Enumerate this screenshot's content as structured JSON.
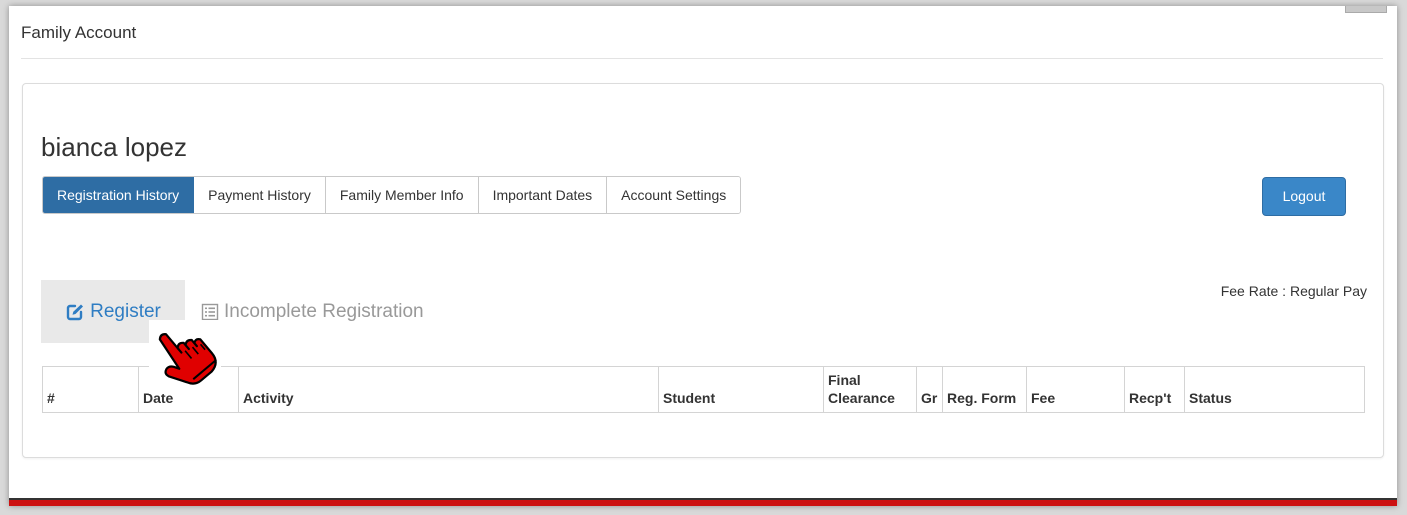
{
  "page": {
    "title": "Family Account"
  },
  "account": {
    "name": "bianca lopez"
  },
  "tabs": [
    {
      "label": "Registration History",
      "active": true
    },
    {
      "label": "Payment History",
      "active": false
    },
    {
      "label": "Family Member Info",
      "active": false
    },
    {
      "label": "Important Dates",
      "active": false
    },
    {
      "label": "Account Settings",
      "active": false
    }
  ],
  "logout": {
    "label": "Logout"
  },
  "fee_rate": "Fee Rate : Regular Pay",
  "sub_tabs": {
    "register": {
      "label": "Register",
      "icon": "edit-icon"
    },
    "incomplete": {
      "label": "Incomplete Registration",
      "icon": "list-icon"
    }
  },
  "table": {
    "columns": [
      {
        "label": "#"
      },
      {
        "label": "Date"
      },
      {
        "label": "Activity"
      },
      {
        "label": "Student"
      },
      {
        "label": "Final Clearance"
      },
      {
        "label": "Gr"
      },
      {
        "label": "Reg. Form"
      },
      {
        "label": "Fee"
      },
      {
        "label": "Recp't"
      },
      {
        "label": "Status"
      }
    ],
    "rows": []
  },
  "colors": {
    "primary": "#2e6da4",
    "logout": "#3a87c8",
    "link": "#2f7dc3",
    "muted": "#999999",
    "footer_bar": "#cc1111",
    "cursor": "#e00000"
  },
  "cursor": {
    "icon": "hand-pointer-icon"
  }
}
